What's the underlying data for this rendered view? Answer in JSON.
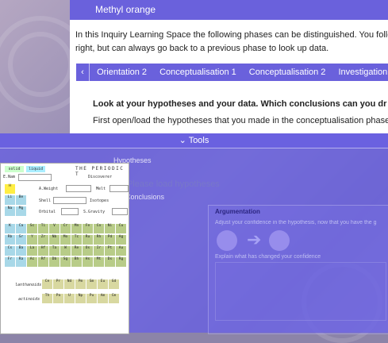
{
  "window": {
    "title": "Methyl orange"
  },
  "intro": {
    "line1": "In this Inquiry Learning Space the following phases can be distinguished. You follow",
    "line2": "right, but can always go back to a previous phase to look up data."
  },
  "phase_tabs": [
    {
      "label": "Orientation 2"
    },
    {
      "label": "Conceptualisation 1"
    },
    {
      "label": "Conceptualisation 2"
    },
    {
      "label": "Investigation"
    }
  ],
  "main": {
    "question": "Look at your hypotheses and your data. Which conclusions can you dr",
    "instruction": "First open/load the hypotheses that you made in the conceptualisation phase"
  },
  "tools": {
    "label": "Tools",
    "hypotheses_heading": "Hypotheses",
    "load_hypotheses": "Please load hypotheses",
    "conclusions_heading": "Conclusions",
    "argumentation_title": "Argumentation",
    "argumentation_text": "Adjust your confidence in the hypothesis, now that you have the g",
    "explain_text": "Explain what has changed your confidence"
  },
  "periodic_table": {
    "btn_solid": "solid",
    "btn_liquid": "liquid",
    "title": "THE PERIODIC T",
    "element_label": "E.Nam",
    "discoverer_label": "Discoverer",
    "weight_label": "A.Weight",
    "melt_label": "Melt",
    "boil_label": "Boili",
    "shell_label": "Shell",
    "isotopes_label": "Isotopes",
    "orbital_label": "Orbital",
    "gravity_label": "S.Gravity",
    "lanthanoids": "lanthanoids",
    "actinoids": "actinoids",
    "rows": [
      [
        "H"
      ],
      [
        "Li",
        "Be",
        "B",
        "C",
        "N",
        "O",
        "F",
        "Ne"
      ],
      [
        "Na",
        "Mg",
        "Al",
        "Si",
        "P",
        "S",
        "Cl",
        "Ar"
      ],
      [
        "K",
        "Ca",
        "Sc",
        "Ti",
        "V",
        "Cr",
        "Mn",
        "Fe",
        "Co",
        "Ni",
        "Cu"
      ],
      [
        "Rb",
        "Sr",
        "Y",
        "Zr",
        "Nb",
        "Mo",
        "Tc",
        "Ru",
        "Rh",
        "Pd",
        "Ag"
      ],
      [
        "Cs",
        "Ba",
        "La",
        "Hf",
        "Ta",
        "W",
        "Re",
        "Os",
        "Ir",
        "Pt",
        "Au"
      ],
      [
        "Fr",
        "Ra",
        "Ac",
        "Rf",
        "Db",
        "Sg",
        "Bh",
        "Hs",
        "Mt",
        "Ds",
        "Rg"
      ]
    ],
    "lanthanoid_row": [
      "Ce",
      "Pr",
      "Nd",
      "Pm",
      "Sm",
      "Eu",
      "Gd"
    ],
    "actinoid_row": [
      "Th",
      "Pa",
      "U",
      "Np",
      "Pu",
      "Am",
      "Cm"
    ]
  }
}
